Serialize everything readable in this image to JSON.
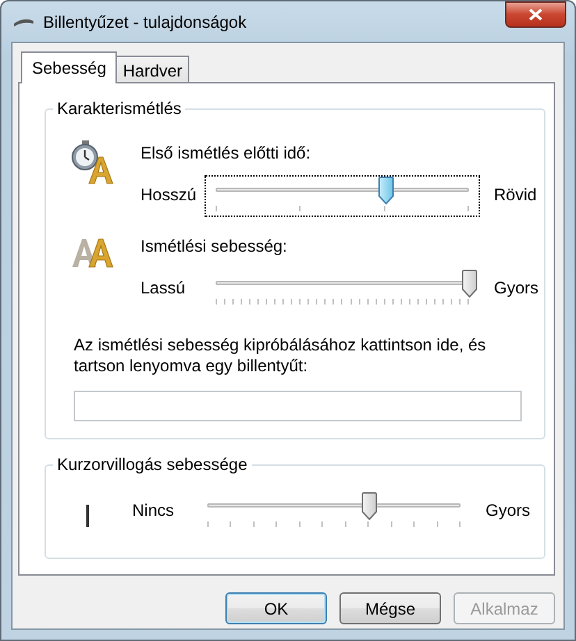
{
  "window": {
    "title": "Billentyűzet - tulajdonságok"
  },
  "tabs": [
    {
      "label": "Sebesség",
      "selected": true
    },
    {
      "label": "Hardver",
      "selected": false
    }
  ],
  "repeat_group": {
    "title": "Karakterismétlés",
    "sliders": [
      {
        "kind": "delay",
        "label": "Első ismétlés előtti idő:",
        "left": "Hosszú",
        "right": "Rövid",
        "level": 0.67,
        "focused": true
      },
      {
        "kind": "rate",
        "label": "Ismétlési sebesség:",
        "left": "Lassú",
        "right": "Gyors",
        "level": 1.0,
        "focused": false
      }
    ],
    "test_text": "Az ismétlési sebesség kipróbálásához kattintson ide, és tartson lenyomva egy billentyűt:"
  },
  "cursor_group": {
    "title": "Kurzorvillogás sebessége",
    "slider": {
      "kind": "blink",
      "left": "Nincs",
      "right": "Gyors",
      "level": 0.64,
      "focused": false
    }
  },
  "buttons": [
    {
      "label": "OK",
      "default": true,
      "disabled": false
    },
    {
      "label": "Mégse",
      "default": false,
      "disabled": false
    },
    {
      "label": "Alkalmaz",
      "default": false,
      "disabled": true
    }
  ]
}
